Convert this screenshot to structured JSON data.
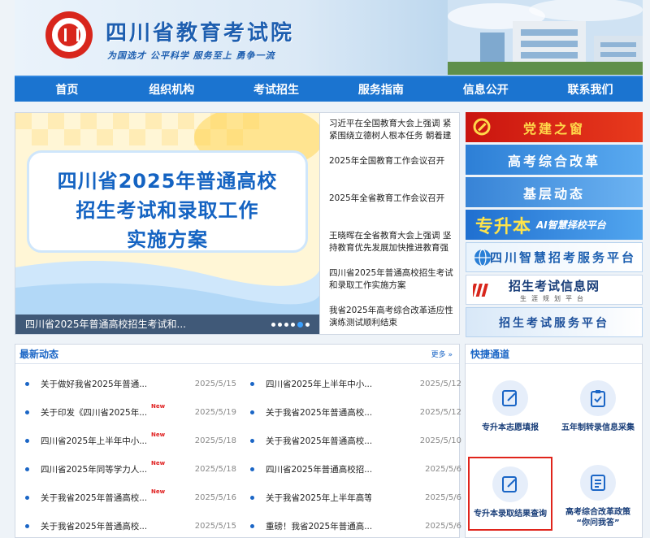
{
  "header": {
    "title": "四川省教育考试院",
    "slogan": "为国选才  公平科学  服务至上  勇争一流"
  },
  "nav": [
    "首页",
    "组织机构",
    "考试招生",
    "服务指南",
    "信息公开",
    "联系我们"
  ],
  "banner": {
    "lines": [
      "四川省2025年普通高校",
      "招生考试和录取工作",
      "实施方案"
    ],
    "caption": "四川省2025年普通高校招生考试和..."
  },
  "headlines": [
    "习近平在全国教育大会上强调 紧紧围绕立德树人根本任务 朝着建成...",
    "2025年全国教育工作会议召开",
    "2025年全省教育工作会议召开",
    "王晓晖在全省教育大会上强调 坚持教育优先发展加快推进教育强省...",
    "四川省2025年普通高校招生考试和录取工作实施方案",
    "我省2025年高考综合改革适应性演练测试顺利结束"
  ],
  "side_banners": {
    "dangjian": "党建之窗",
    "gaokao_reform": "高考综合改革",
    "jiceng": "基层动态",
    "zsb_big": "专升本",
    "zsb_small": "AI智慧择校平台",
    "zhihui": "四川智慧招考服务平台",
    "xinxi": "招生考试信息网",
    "xinxi_sub": "生涯规划平台",
    "fuwu": "招生考试服务平台"
  },
  "news": {
    "title": "最新动态",
    "more": "更多 »",
    "new_label": "New",
    "left": [
      {
        "text": "关于做好我省2025年普通...",
        "date": "2025/5/15",
        "new": false
      },
      {
        "text": "关于印发《四川省2025年...",
        "date": "2025/5/19",
        "new": true
      },
      {
        "text": "四川省2025年上半年中小...",
        "date": "2025/5/18",
        "new": true
      },
      {
        "text": "四川省2025年同等学力人...",
        "date": "2025/5/18",
        "new": true
      },
      {
        "text": "关于我省2025年普通高校...",
        "date": "2025/5/16",
        "new": true
      },
      {
        "text": "关于我省2025年普通高校...",
        "date": "2025/5/15",
        "new": false
      }
    ],
    "right": [
      {
        "text": "四川省2025年上半年中小...",
        "date": "2025/5/12",
        "new": false
      },
      {
        "text": "关于我省2025年普通高校...",
        "date": "2025/5/12",
        "new": false
      },
      {
        "text": "关于我省2025年普通高校...",
        "date": "2025/5/10",
        "new": false
      },
      {
        "text": "四川省2025年普通高校招...",
        "date": "2025/5/6",
        "new": false
      },
      {
        "text": "关于我省2025年上半年高等...",
        "date": "2025/5/6",
        "new": false
      },
      {
        "text": "重磅！我省2025年普通高...",
        "date": "2025/5/6",
        "new": false
      }
    ]
  },
  "quick": {
    "title": "快捷通道",
    "items": [
      "专升本志愿填报",
      "五年制转录信息采集",
      "专升本录取结果查询",
      "高考综合改革政策\n“你问我答”"
    ]
  },
  "colors": {
    "primary": "#1b74d0",
    "accent_red": "#e0241b",
    "text_blue": "#1b66c6"
  }
}
